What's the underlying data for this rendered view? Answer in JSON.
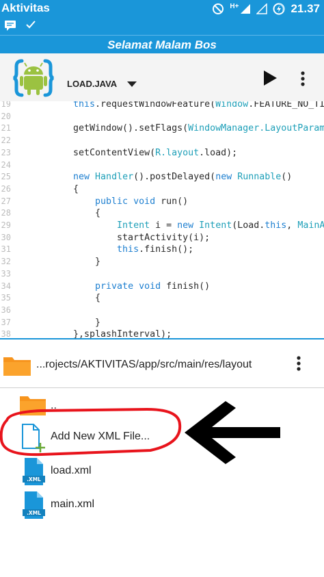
{
  "status_bar": {
    "app_name": "Aktivitas",
    "network_label": "H+",
    "time": "21.37"
  },
  "banner": {
    "text": "Selamat Malam Bos"
  },
  "toolbar": {
    "file_title": "LOAD.JAVA",
    "logo_icon": "android-braces-logo",
    "run_icon": "play-icon",
    "menu_icon": "overflow-menu-icon"
  },
  "editor": {
    "line_numbers": [
      "19",
      "20",
      "21",
      "22",
      "23",
      "24",
      "25",
      "26",
      "27",
      "28",
      "29",
      "30",
      "31",
      "32",
      "33",
      "34",
      "35",
      "36",
      "37",
      "38"
    ],
    "lines": [
      "this.requestWindowFeature(Window.FEATURE_NO_TIT",
      "",
      "getWindow().setFlags(WindowManager.LayoutParams",
      "",
      "setContentView(R.layout.load);",
      "",
      "new Handler().postDelayed(new Runnable()",
      "{",
      "    public void run()",
      "    {",
      "        Intent i = new Intent(Load.this, MainAc",
      "        startActivity(i);",
      "        this.finish();",
      "    }",
      "",
      "    private void finish()",
      "    {",
      "",
      "    }",
      "},splashInterval);"
    ]
  },
  "file_browser": {
    "path": "...rojects/AKTIVITAS/app/src/main/res/layout",
    "items": [
      {
        "label": "..",
        "icon": "folder-icon"
      },
      {
        "label": "Add New XML File...",
        "icon": "add-file-icon"
      },
      {
        "label": "load.xml",
        "icon": "xml-file-icon",
        "badge": ".XML"
      },
      {
        "label": "main.xml",
        "icon": "xml-file-icon",
        "badge": ".XML"
      }
    ]
  },
  "colors": {
    "accent": "#1a96d9",
    "folder": "#f7941d",
    "annotation_red": "#e8141c"
  }
}
